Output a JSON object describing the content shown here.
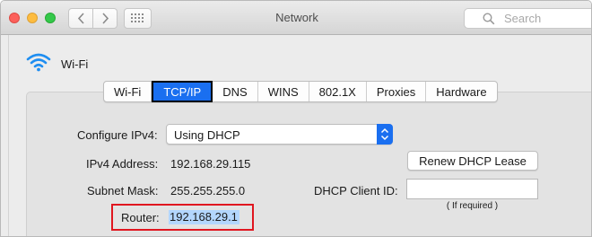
{
  "window": {
    "title": "Network",
    "search": {
      "placeholder": "Search"
    }
  },
  "interface": {
    "name": "Wi-Fi",
    "icon": "wifi-icon"
  },
  "tabs": [
    {
      "label": "Wi-Fi",
      "selected": false
    },
    {
      "label": "TCP/IP",
      "selected": true
    },
    {
      "label": "DNS",
      "selected": false
    },
    {
      "label": "WINS",
      "selected": false
    },
    {
      "label": "802.1X",
      "selected": false
    },
    {
      "label": "Proxies",
      "selected": false
    },
    {
      "label": "Hardware",
      "selected": false
    }
  ],
  "tcpip": {
    "configure_label": "Configure IPv4:",
    "configure_value": "Using DHCP",
    "ipv4_label": "IPv4 Address:",
    "ipv4_value": "192.168.29.115",
    "subnet_label": "Subnet Mask:",
    "subnet_value": "255.255.255.0",
    "router_label": "Router:",
    "router_value": "192.168.29.1",
    "renew_button": "Renew DHCP Lease",
    "client_id_label": "DHCP Client ID:",
    "client_id_value": "",
    "client_id_hint": "( If required )"
  },
  "colors": {
    "accent": "#1a6ff0",
    "highlight_box": "#e0161f",
    "selection": "#b3d6fd"
  }
}
